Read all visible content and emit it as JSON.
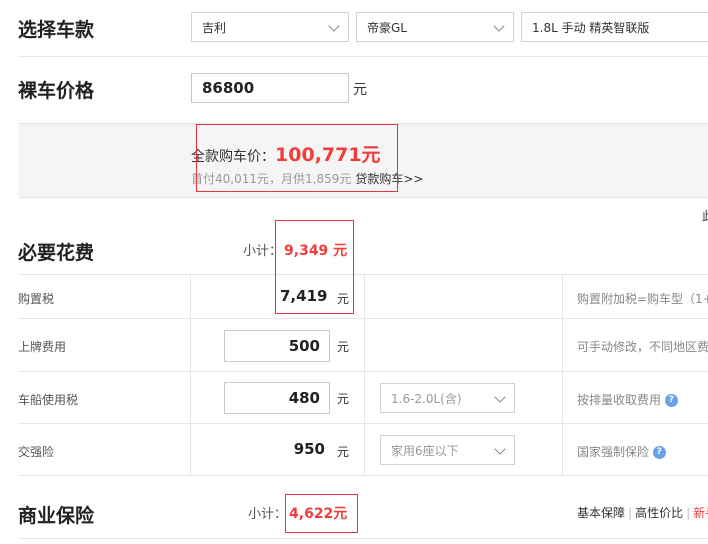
{
  "select_car": {
    "title": "选择车款",
    "brand": "吉利",
    "series": "帝豪GL",
    "model": "1.8L 手动 精英智联版"
  },
  "naked_price": {
    "title": "裸车价格",
    "value": "86800",
    "unit": "元"
  },
  "summary": {
    "total_label": "全款购车价：",
    "total_value": "100,771元",
    "down_payment": "首付40,011元，月供1,859元",
    "loan_link": "贷款购车>>",
    "edge_text": "此"
  },
  "required": {
    "title": "必要花费",
    "subtotal_label": "小计：",
    "subtotal_value": "9,349 元",
    "rows": [
      {
        "label": "购置税",
        "value": "7,419",
        "unit": "元",
        "select": "",
        "note": "购置附加税=购车型（1+"
      },
      {
        "label": "上牌费用",
        "value": "500",
        "unit": "元",
        "select": "",
        "note": "可手动修改，不同地区费"
      },
      {
        "label": "车船使用税",
        "value": "480",
        "unit": "元",
        "select": "1.6-2.0L(含)",
        "note": "按排量收取费用"
      },
      {
        "label": "交强险",
        "value": "950",
        "unit": "元",
        "select": "家用6座以下",
        "note": "国家强制保险"
      }
    ]
  },
  "commercial": {
    "title": "商业保险",
    "subtotal_label": "小计：",
    "subtotal_value": "4,622元",
    "tabs": [
      "基本保障",
      "高性价比",
      "新手"
    ],
    "separator": "|"
  },
  "colors": {
    "accent_red": "#f23c3c",
    "box_red": "#e0373a",
    "help_blue": "#6aa2e8"
  }
}
